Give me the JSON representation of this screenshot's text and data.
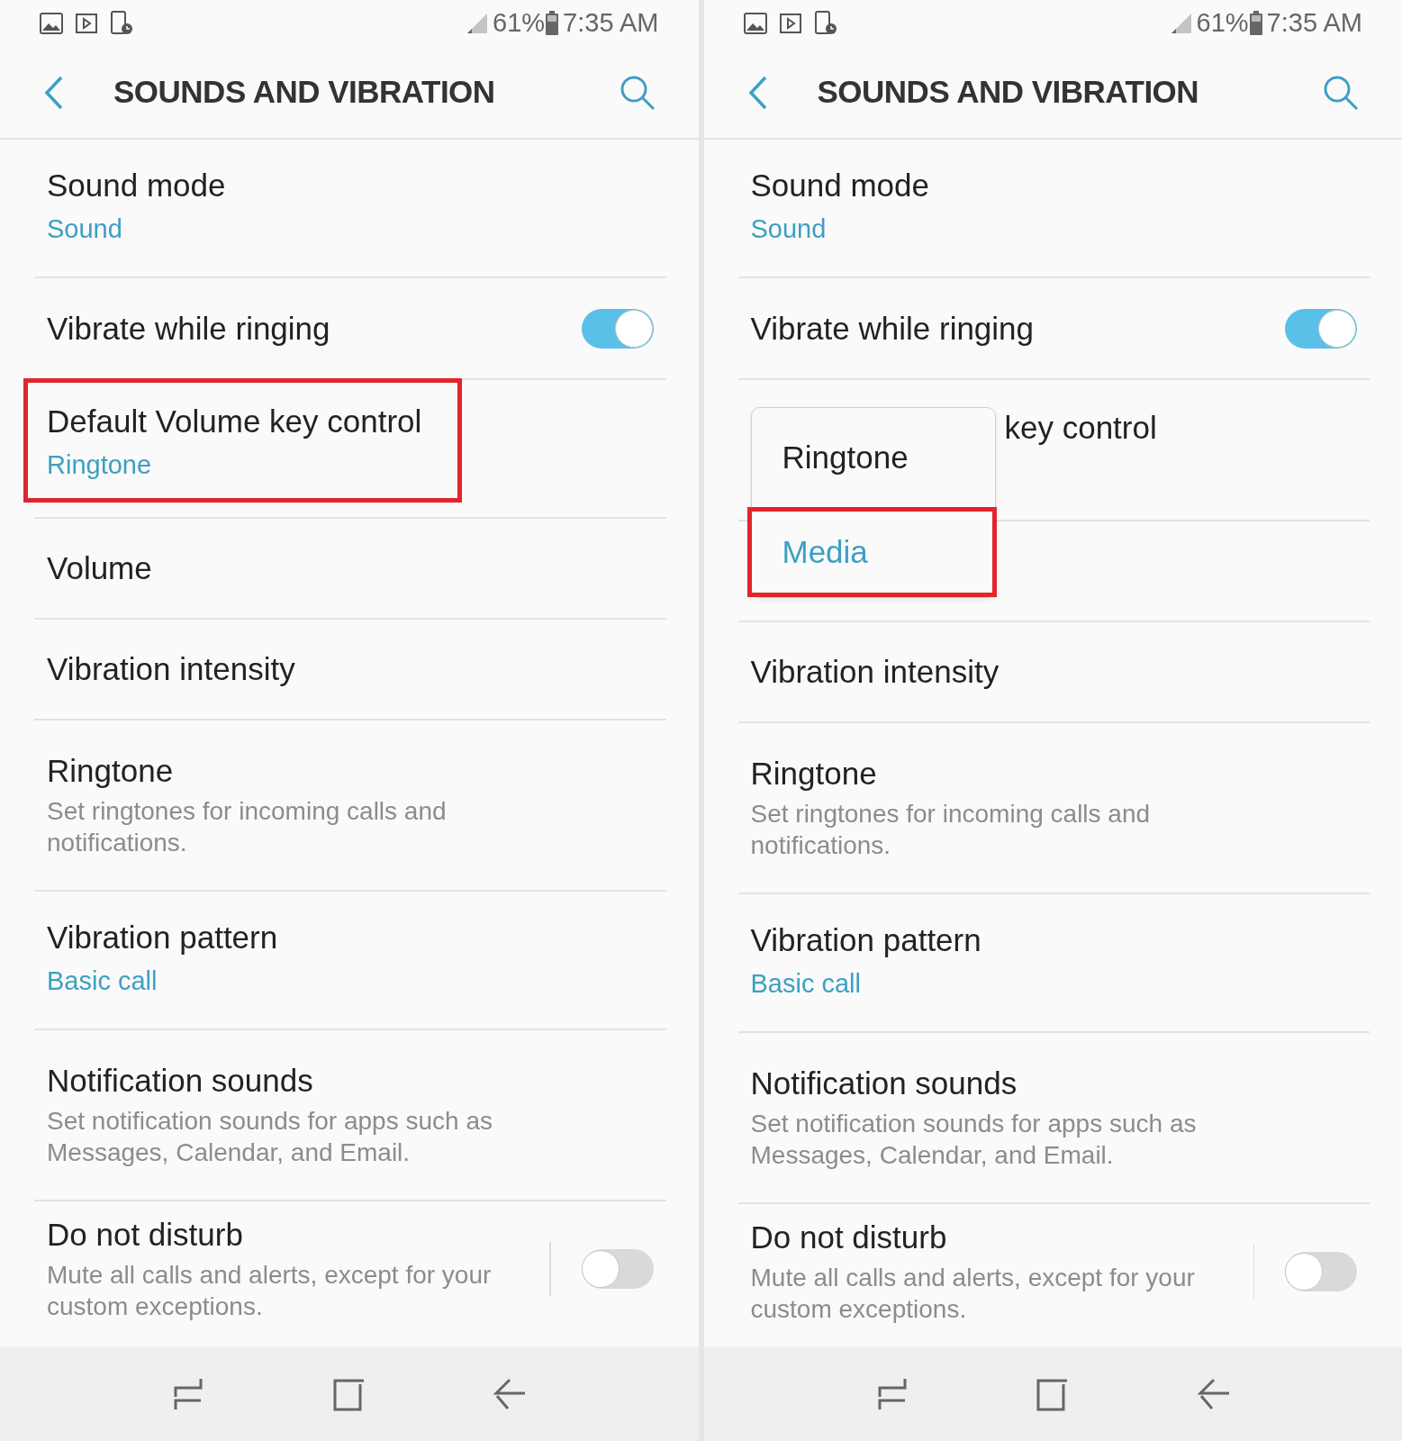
{
  "screens": [
    {
      "status_bar": {
        "battery": "61%",
        "time": "7:35 AM"
      },
      "header": {
        "title": "SOUNDS AND VIBRATION"
      },
      "settings": [
        {
          "kind": "value",
          "title": "Sound mode",
          "value": "Sound"
        },
        {
          "kind": "toggle",
          "title": "Vibrate while ringing",
          "on": true
        },
        {
          "kind": "value",
          "title": "Default Volume key control",
          "value": "Ringtone",
          "highlighted": true
        },
        {
          "kind": "plain",
          "title": "Volume"
        },
        {
          "kind": "plain",
          "title": "Vibration intensity"
        },
        {
          "kind": "description",
          "title": "Ringtone",
          "description": "Set ringtones for incoming calls and notifications."
        },
        {
          "kind": "value",
          "title": "Vibration pattern",
          "value": "Basic call"
        },
        {
          "kind": "description",
          "title": "Notification sounds",
          "description": "Set notification sounds for apps such as Messages, Calendar, and Email."
        },
        {
          "kind": "toggle",
          "title": "Do not disturb",
          "description": "Mute all calls and alerts, except for your custom exceptions.",
          "on": false
        }
      ]
    },
    {
      "status_bar": {
        "battery": "61%",
        "time": "7:35 AM"
      },
      "header": {
        "title": "SOUNDS AND VIBRATION"
      },
      "settings": [
        {
          "kind": "value",
          "title": "Sound mode",
          "value": "Sound"
        },
        {
          "kind": "toggle",
          "title": "Vibrate while ringing",
          "on": true
        },
        {
          "kind": "popup",
          "title": "key control",
          "options": [
            {
              "label": "Ringtone",
              "selected": false,
              "highlighted": false
            },
            {
              "label": "Media",
              "selected": true,
              "highlighted": true
            }
          ]
        },
        {
          "kind": "plain",
          "title": "Vibration intensity"
        },
        {
          "kind": "description",
          "title": "Ringtone",
          "description": "Set ringtones for incoming calls and notifications."
        },
        {
          "kind": "value",
          "title": "Vibration pattern",
          "value": "Basic call"
        },
        {
          "kind": "description",
          "title": "Notification sounds",
          "description": "Set notification sounds for apps such as Messages, Calendar, and Email."
        },
        {
          "kind": "toggle",
          "title": "Do not disturb",
          "description": "Mute all calls and alerts, except for your custom exceptions.",
          "on": false
        }
      ]
    }
  ]
}
